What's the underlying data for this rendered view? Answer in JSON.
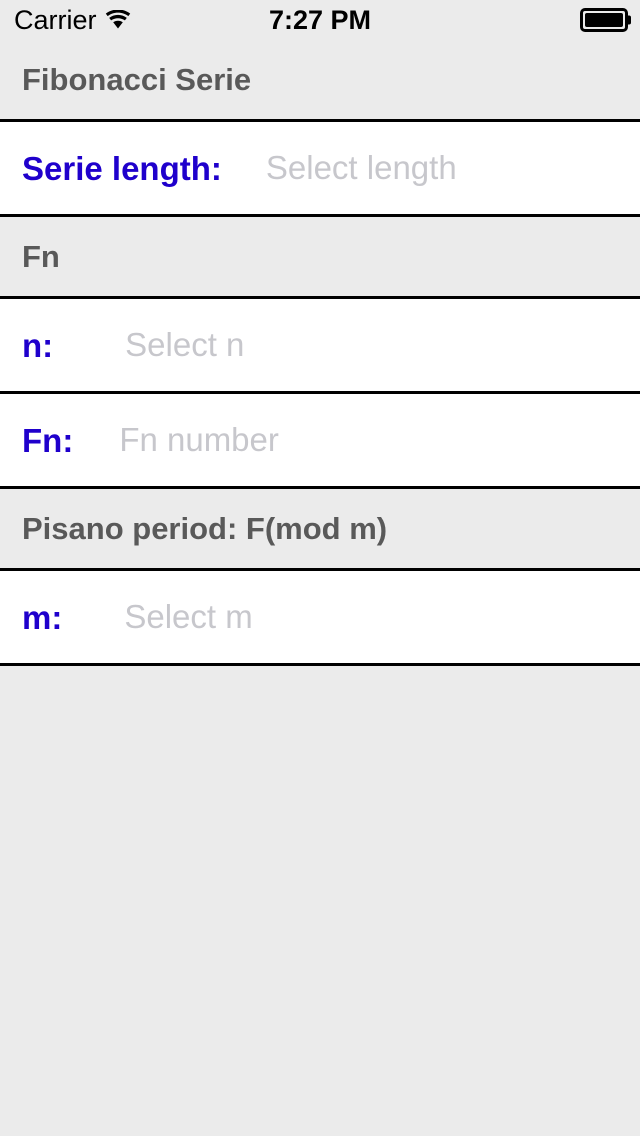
{
  "status_bar": {
    "carrier": "Carrier",
    "wifi_icon": "wifi-icon",
    "time": "7:27 PM",
    "battery_icon": "battery-full-icon"
  },
  "colors": {
    "label_blue": "#1f00cc",
    "section_header_gray": "#595959",
    "placeholder_gray": "#c7c7cc",
    "background_gray": "#ebebeb",
    "row_background": "#ffffff",
    "separator": "#000000"
  },
  "sections": [
    {
      "header": "Fibonacci Serie",
      "rows": [
        {
          "label": "Serie length:",
          "value": "",
          "placeholder": "Select length"
        }
      ]
    },
    {
      "header": "Fn",
      "rows": [
        {
          "label": "n:",
          "value": "",
          "placeholder": "Select n"
        },
        {
          "label": "Fn:",
          "value": "",
          "placeholder": "Fn number"
        }
      ]
    },
    {
      "header": "Pisano period: F(mod m)",
      "rows": [
        {
          "label": "m:",
          "value": "",
          "placeholder": "Select m"
        }
      ]
    }
  ]
}
